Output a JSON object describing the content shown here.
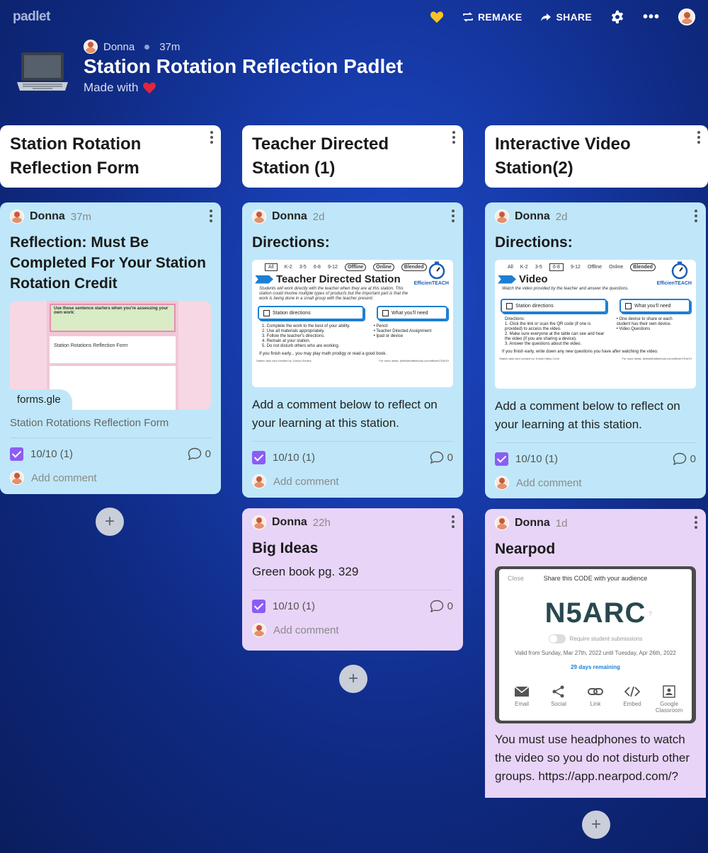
{
  "topbar": {
    "brand": "padlet",
    "remake_label": "REMAKE",
    "share_label": "SHARE"
  },
  "header": {
    "author": "Donna",
    "time": "37m",
    "title": "Station Rotation Reflection Padlet",
    "subtitle": "Made with"
  },
  "columns": [
    {
      "title": "Station Rotation Reflection Form",
      "cards": [
        {
          "author": "Donna",
          "time": "37m",
          "title": "Reflection: Must Be Completed For Your Station Rotation Credit",
          "link_domain": "forms.gle",
          "link_title": "Station Rotations Reflection Form",
          "preview_banner": "Use these sentence starters when you're assessing your own work:",
          "preview_form_title": "Station Rotations Reflection Form",
          "rating": "10/10 (1)",
          "comments": "0",
          "add_comment": "Add comment"
        }
      ]
    },
    {
      "title": "Teacher Directed Station (1)",
      "cards": [
        {
          "author": "Donna",
          "time": "2d",
          "title": "Directions:",
          "image": {
            "filters": [
              "All",
              "K-2",
              "3-5",
              "6-8",
              "9-12"
            ],
            "pills": [
              "Offline",
              "Online",
              "Blended"
            ],
            "heading": "Teacher Directed Station",
            "brand": "EfficienTEACH",
            "desc": "Students will work directly with the teacher when they are at this station. This station could involve multiple types of products but the important part is that the work is being done in a small group with the teacher present.",
            "box_left": "Station directions",
            "box_right": "What you'll need",
            "steps": [
              "1. Complete the work to the best of your ability.",
              "2. Use all materials appropriately.",
              "3. Follow the teacher's directions.",
              "4. Remain at your station.",
              "5. Do not disturb others who are working."
            ],
            "needs": [
              "• Pencil",
              "• Teacher Directed Assignment",
              "• Ipad or device"
            ],
            "note": "If you finish early... you may play math prodigy or read a good book.",
            "foot_left": "Station task card created by: Donna Schiles",
            "foot_right": "For more ideas: @thinkthatteebook.com/efficienTEACH"
          },
          "body": "Add a comment below to reflect on your learning at this station.",
          "rating": "10/10 (1)",
          "comments": "0",
          "add_comment": "Add comment"
        },
        {
          "author": "Donna",
          "time": "22h",
          "title": "Big Ideas",
          "body": "Green book pg. 329",
          "rating": "10/10 (1)",
          "comments": "0",
          "add_comment": "Add comment"
        }
      ]
    },
    {
      "title": "Interactive Video Station(2)",
      "cards": [
        {
          "author": "Donna",
          "time": "2d",
          "title": "Directions:",
          "image": {
            "filters": [
              "All",
              "K-2",
              "3-5",
              "6-8",
              "9-12"
            ],
            "pills": [
              "Offline",
              "Online",
              "Blended"
            ],
            "heading": "Video",
            "brand": "EfficienTEACH",
            "desc": "Watch the video provided by the teacher and answer the questions.",
            "box_left": "Station directions",
            "box_right": "What you'll need",
            "steps": [
              "Directions:",
              "1. Click the link or scan the QR code (if one is provided) to access the video.",
              "2. Make sure everyone at the table can see and hear the video (if you are sharing a device).",
              "3. Answer the questions about the video."
            ],
            "needs": [
              "• One device to share or each student has their own device.",
              "• Video Questions"
            ],
            "note": "If you finish early, write down any new questions you have after watching the video.",
            "foot_left": "Station task card created by: Kristin Haley Conti",
            "foot_right": "For more ideas: @thinkthatteebook.com/efficienTEACH"
          },
          "body": "Add a comment below to reflect on your learning at this station.",
          "rating": "10/10 (1)",
          "comments": "0",
          "add_comment": "Add comment"
        },
        {
          "author": "Donna",
          "time": "1d",
          "title": "Nearpod",
          "nearpod": {
            "close": "Close",
            "share": "Share this CODE with your audience",
            "code": "N5ARC",
            "question": "?",
            "require": "Require student submissions",
            "valid": "Valid from Sunday, Mar 27th, 2022 until Tuesday, Apr 26th, 2022",
            "days": "29 days remaining",
            "tools": [
              "Email",
              "Social",
              "Link",
              "Embed",
              "Google Classroom"
            ]
          },
          "body": "You must use headphones to watch the video so you do not disturb other groups. https://app.nearpod.com/?"
        }
      ]
    }
  ],
  "plus_symbol": "+",
  "colors": {
    "card_blue": "#bfe7f9",
    "card_purple": "#e8d4f7",
    "check_purple": "#8b5cf6",
    "background": "#163aa8"
  }
}
